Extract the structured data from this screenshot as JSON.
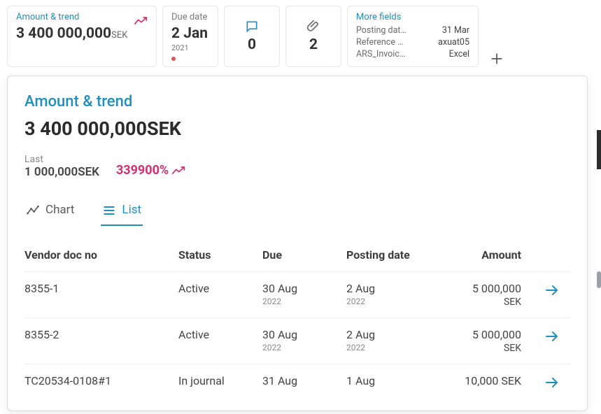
{
  "cards": {
    "amount": {
      "label": "Amount & trend",
      "value": "3 400 000,000",
      "unit": "SEK"
    },
    "due": {
      "label": "Due date",
      "value": "2 Jan",
      "year": "2021"
    },
    "comments": {
      "count": "0"
    },
    "attachments": {
      "count": "2"
    },
    "more": {
      "label": "More fields",
      "rows": [
        {
          "k": "Posting dat…",
          "v": "31 Mar"
        },
        {
          "k": "Reference …",
          "v": "axuat05"
        },
        {
          "k": "ARS_Invoic…",
          "v": "Excel"
        }
      ]
    }
  },
  "panel": {
    "title": "Amount & trend",
    "amount": "3 400 000,000",
    "unit": "SEK",
    "last_label": "Last",
    "last_value": "1 000,000",
    "last_unit": "SEK",
    "pct": "339900%"
  },
  "tabs": {
    "chart": "Chart",
    "list": "List",
    "active": "list"
  },
  "table": {
    "headers": {
      "vendor": "Vendor doc no",
      "status": "Status",
      "due": "Due",
      "posting": "Posting date",
      "amount": "Amount"
    },
    "rows": [
      {
        "vendor": "8355-1",
        "status": "Active",
        "due": "30 Aug",
        "due_year": "2022",
        "posting": "2 Aug",
        "posting_year": "2022",
        "amount": "5 000,000",
        "currency": "SEK"
      },
      {
        "vendor": "8355-2",
        "status": "Active",
        "due": "30 Aug",
        "due_year": "2022",
        "posting": "2 Aug",
        "posting_year": "2022",
        "amount": "5 000,000",
        "currency": "SEK"
      },
      {
        "vendor": "TC20534-0108#1",
        "status": "In journal",
        "due": "31 Aug",
        "due_year": "",
        "posting": "1 Aug",
        "posting_year": "",
        "amount": "10,000 SEK",
        "currency": ""
      }
    ]
  }
}
